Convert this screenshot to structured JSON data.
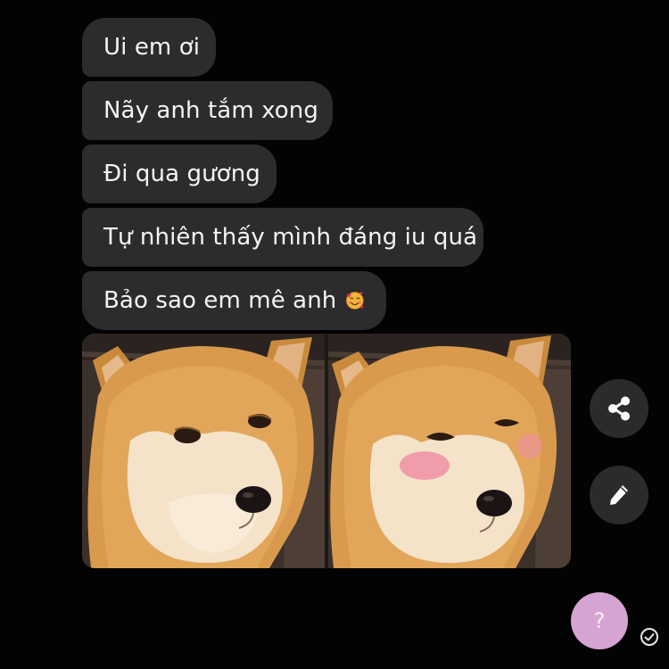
{
  "messages": [
    {
      "text": "Ui em ơi"
    },
    {
      "text": "Nãy anh tắm xong"
    },
    {
      "text": "Đi qua gương"
    },
    {
      "text": "Tự nhiên thấy mình đáng iu quá"
    },
    {
      "text": "Bảo sao em mê anh",
      "emoji": "smiling-face-with-hearts-icon"
    }
  ],
  "attachment": {
    "panels": [
      "shiba-dog-neutral",
      "shiba-dog-blushing"
    ]
  },
  "actions": {
    "share_icon": "share-icon",
    "edit_icon": "pencil-icon",
    "help_label": "?",
    "status_icon": "check-circle-icon"
  },
  "colors": {
    "background": "#030303",
    "bubble": "#2c2c2e",
    "bubble_text": "#f4f4f4",
    "action_button": "#2b2b2d",
    "help_button": "#d6a4d3"
  }
}
